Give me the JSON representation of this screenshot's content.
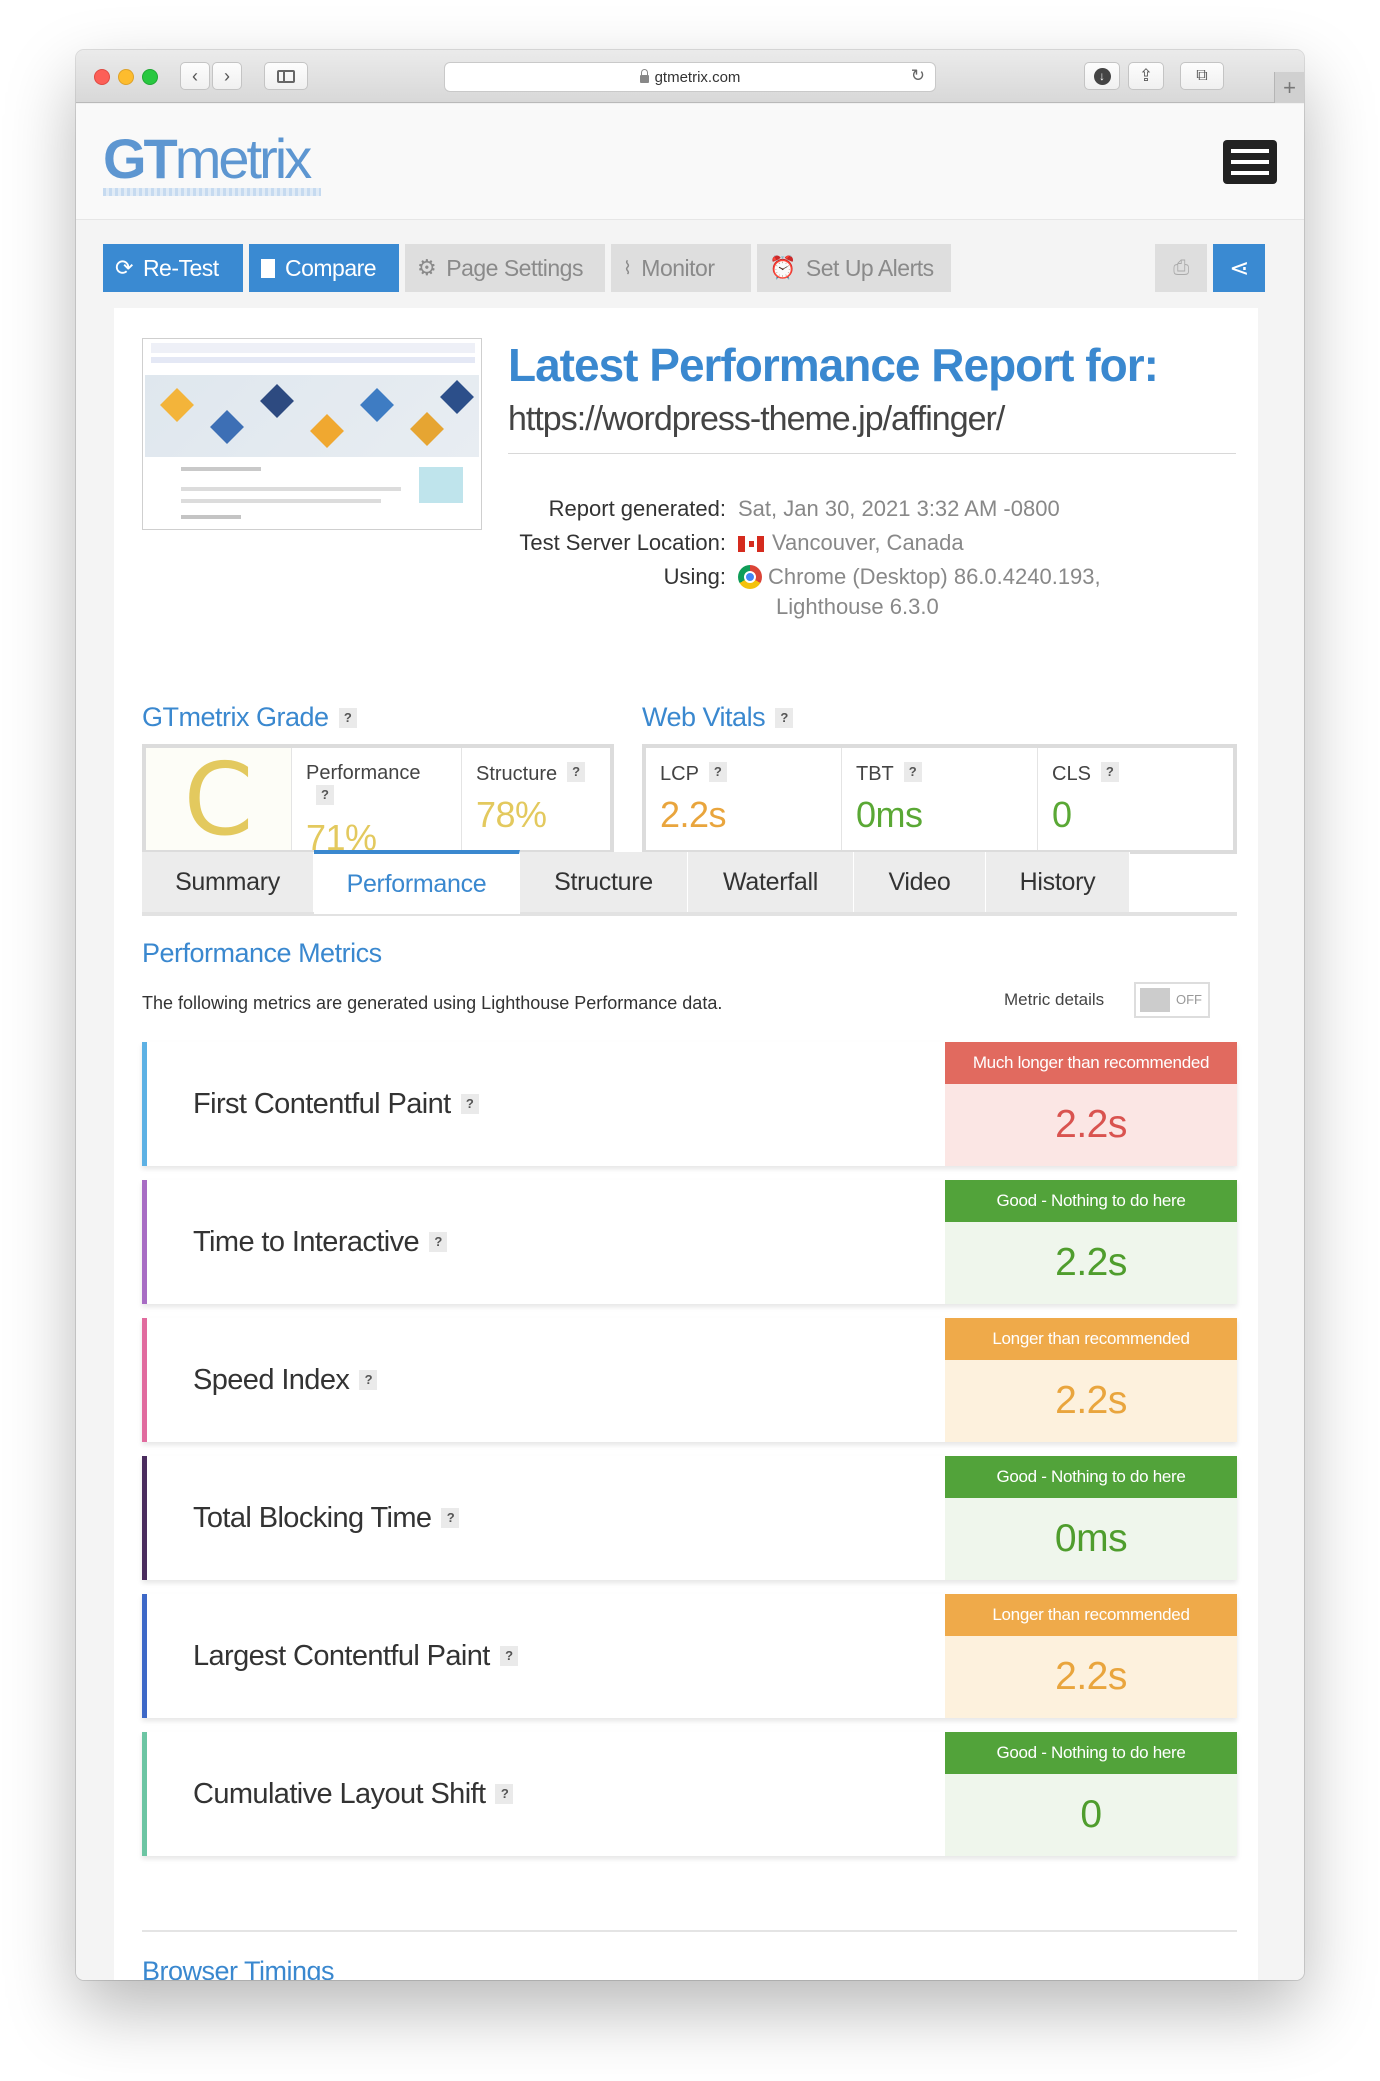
{
  "browser": {
    "url": "gtmetrix.com"
  },
  "app": {
    "logo_dark": "GT",
    "logo_light": "metrix"
  },
  "toolbar": {
    "retest": "Re-Test",
    "compare": "Compare",
    "page_settings": "Page Settings",
    "monitor": "Monitor",
    "alerts": "Set Up Alerts"
  },
  "report": {
    "title": "Latest Performance Report for:",
    "url": "https://wordpress-theme.jp/affinger/",
    "generated_label": "Report generated:",
    "generated_value": "Sat, Jan 30, 2021 3:32 AM -0800",
    "location_label": "Test Server Location:",
    "location_value": "Vancouver, Canada",
    "using_label": "Using:",
    "using_value": "Chrome (Desktop) 86.0.4240.193,",
    "using_value2": "Lighthouse 6.3.0"
  },
  "grade": {
    "title": "GTmetrix Grade",
    "letter": "C",
    "performance_label": "Performance",
    "performance_value": "71%",
    "structure_label": "Structure",
    "structure_value": "78%",
    "color": "#e3c95e"
  },
  "vitals": {
    "title": "Web Vitals",
    "items": [
      {
        "label": "LCP",
        "value": "2.2s",
        "color": "#e9a53d"
      },
      {
        "label": "TBT",
        "value": "0ms",
        "color": "#5aa835"
      },
      {
        "label": "CLS",
        "value": "0",
        "color": "#5aa835"
      }
    ]
  },
  "tabs": [
    {
      "label": "Summary"
    },
    {
      "label": "Performance",
      "active": true
    },
    {
      "label": "Structure"
    },
    {
      "label": "Waterfall"
    },
    {
      "label": "Video"
    },
    {
      "label": "History"
    }
  ],
  "performance": {
    "title": "Performance Metrics",
    "description": "The following metrics are generated using Lighthouse Performance data.",
    "toggle_label": "Metric details",
    "toggle_state": "OFF",
    "metrics": [
      {
        "name": "First Contentful Paint",
        "status": "Much longer than recommended",
        "value": "2.2s",
        "color": "#5db1e4",
        "status_color": "#e16a5f",
        "value_color": "#d9534f",
        "value_bg": "#fbe6e4"
      },
      {
        "name": "Time to Interactive",
        "status": "Good - Nothing to do here",
        "value": "2.2s",
        "color": "#a86cc4",
        "status_color": "#52a33a",
        "value_color": "#4f9d2d",
        "value_bg": "#eff6ec"
      },
      {
        "name": "Speed Index",
        "status": "Longer than recommended",
        "value": "2.2s",
        "color": "#e16b9e",
        "status_color": "#efaa4a",
        "value_color": "#e9a53d",
        "value_bg": "#fdf1dd"
      },
      {
        "name": "Total Blocking Time",
        "status": "Good - Nothing to do here",
        "value": "0ms",
        "color": "#4a2c5e",
        "status_color": "#52a33a",
        "value_color": "#4f9d2d",
        "value_bg": "#eff6ec"
      },
      {
        "name": "Largest Contentful Paint",
        "status": "Longer than recommended",
        "value": "2.2s",
        "color": "#3d68c7",
        "status_color": "#efaa4a",
        "value_color": "#e9a53d",
        "value_bg": "#fdf1dd"
      },
      {
        "name": "Cumulative Layout Shift",
        "status": "Good - Nothing to do here",
        "value": "0",
        "color": "#6cc5a3",
        "status_color": "#52a33a",
        "value_color": "#4f9d2d",
        "value_bg": "#eff6ec"
      }
    ]
  },
  "browser_timings": {
    "title": "Browser Timings"
  }
}
